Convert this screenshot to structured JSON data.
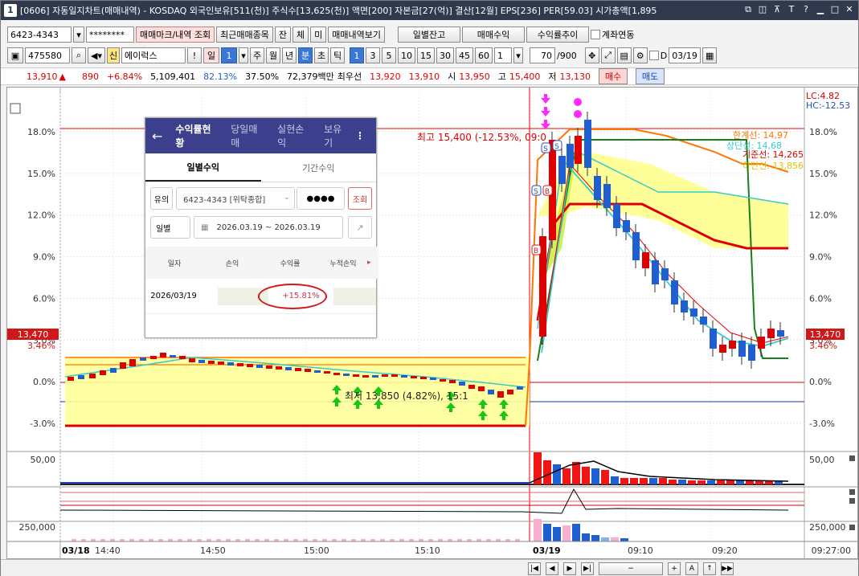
{
  "title": {
    "number": "1",
    "text": "[0606] 자동일지차트(매매내역) - KOSDAQ 외국인보유[511(천)] 주식수[13,625(천)] 액면[200] 자본금[27(억)] 결산[12월] EPS[236] PER[59.03] 시가총액[1,895"
  },
  "toolbar1": {
    "account": "6423-4343",
    "password": "********",
    "tradeMarkBtn": "매매마크/내역 조회",
    "recentBtn": "최근매매종목",
    "jan": "잔",
    "che": "체",
    "mi": "미",
    "tradeViewBtn": "매매내역보기",
    "dailyBalance": "일별잔고",
    "tradeProfit": "매매수익",
    "profitTrend": "수익률추이",
    "linkAccount": "계좌연동"
  },
  "toolbar2": {
    "code": "475580",
    "marker": "신",
    "name": "에이럭스",
    "excl": "!",
    "day": "일",
    "dayNum": "1",
    "periods": [
      "주",
      "월",
      "년",
      "분",
      "초",
      "틱"
    ],
    "activePeriod": "분",
    "intervals": [
      "1",
      "3",
      "5",
      "10",
      "15",
      "30",
      "45",
      "60"
    ],
    "activeInterval": "1",
    "sel": "1",
    "count": "70",
    "total": "/900",
    "d": "D",
    "date": "03/19"
  },
  "quote": {
    "price": "13,910",
    "arrow": "▲",
    "change": "890",
    "rate": "+6.84%",
    "volume": "5,109,401",
    "volRate": "82.13%",
    "foreignRate": "37.50%",
    "amount": "72,379백만",
    "bestAskLabel": "최우선",
    "bestAsk": "13,920",
    "bestBid": "13,910",
    "openLabel": "시",
    "open": "13,950",
    "highLabel": "고",
    "high": "15,400",
    "lowLabel": "저",
    "low": "13,130",
    "buy": "매수",
    "sell": "매도"
  },
  "chart": {
    "yTicks": [
      "18.0%",
      "15.0%",
      "12.0%",
      "9.0%",
      "6.0%",
      "3.0%",
      "0.0%",
      "-3.0%"
    ],
    "lc": "LC:4.82",
    "hc": "HC:-12.53",
    "curPrice": "13,470",
    "curRate": "3.46%",
    "highNote": "최고 15,400 (-12.53%, 09:0",
    "lowNote": "최저 13,850 (4.82%), 15:1",
    "legend": {
      "upper": "한계선: 14,97",
      "mid": "상단선: 14,68",
      "base": "기준선: 14,265",
      "lower": "하단선: 13,856"
    },
    "vol1Label": "50,00",
    "vol2Label": "250,000",
    "xTicks": [
      "03/18",
      "14:40",
      "14:50",
      "15:00",
      "15:10",
      "03/19",
      "09:10",
      "09:20"
    ],
    "timeRight": "09:27:00"
  },
  "mobile": {
    "tabs": [
      "수익률현황",
      "당일매매",
      "실현손익",
      "보유기"
    ],
    "activeTab": "수익률현황",
    "subTabs": [
      "일별수익",
      "기간수익"
    ],
    "typeLabel": "유의",
    "account": "6423-4343 [위탁종합]",
    "password": "●●●●",
    "query": "조회",
    "dateType": "일별",
    "dateRange": "2026.03.19 ~ 2026.03.19",
    "columns": [
      "일자",
      "손익",
      "수익률",
      "누적손익"
    ],
    "rowDate": "2026/03/19",
    "rowRate": "+15.81%"
  },
  "colors": {
    "up": "#e00000",
    "down": "#1f5fd0",
    "bandFill": "#ffff99",
    "orange": "#ff7700",
    "green": "#1a7f1a",
    "cyan": "#33cccc"
  }
}
